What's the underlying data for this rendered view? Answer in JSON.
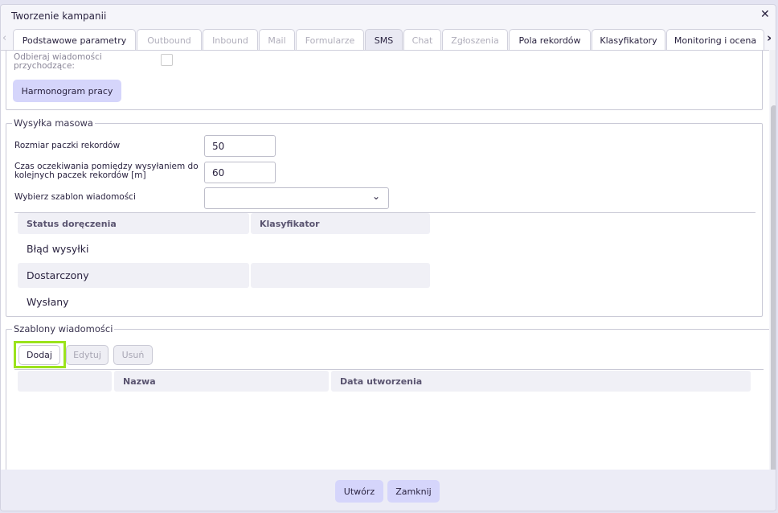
{
  "window": {
    "title": "Tworzenie kampanii",
    "close_icon": "close-icon"
  },
  "tabs": [
    {
      "label": "Podstawowe parametry",
      "state": "enabled"
    },
    {
      "label": "Outbound",
      "state": "disabled"
    },
    {
      "label": "Inbound",
      "state": "disabled"
    },
    {
      "label": "Mail",
      "state": "disabled"
    },
    {
      "label": "Formularze",
      "state": "disabled"
    },
    {
      "label": "SMS",
      "state": "active"
    },
    {
      "label": "Chat",
      "state": "disabled"
    },
    {
      "label": "Zgłoszenia",
      "state": "disabled"
    },
    {
      "label": "Pola rekordów",
      "state": "enabled"
    },
    {
      "label": "Klasyfikatory",
      "state": "enabled"
    },
    {
      "label": "Monitoring i ocena",
      "state": "enabled"
    }
  ],
  "top": {
    "incoming_label": "Odbieraj wiadomości przychodzące:",
    "incoming_checked": false,
    "schedule_button": "Harmonogram pracy"
  },
  "mass": {
    "legend": "Wysyłka masowa",
    "batch_label": "Rozmiar paczki rekordów",
    "batch_value": "50",
    "wait_label": "Czas oczekiwania pomiędzy wysyłaniem do kolejnych paczek rekordów [m]",
    "wait_value": "60",
    "template_label": "Wybierz szablon wiadomości",
    "template_value": "",
    "columns": [
      "Status doręczenia",
      "Klasyfikator"
    ],
    "rows": [
      [
        "Błąd wysyłki",
        ""
      ],
      [
        "Dostarczony",
        ""
      ],
      [
        "Wysłany",
        ""
      ]
    ]
  },
  "templates": {
    "legend": "Szablony wiadomości",
    "add": "Dodaj",
    "edit": "Edytuj",
    "delete": "Usuń",
    "columns": [
      "",
      "Nazwa",
      "Data utworzenia"
    ]
  },
  "footer": {
    "create": "Utwórz",
    "close": "Zamknij"
  },
  "colors": {
    "accent_button": "#d5d5fb",
    "focus_highlight": "#9be31c"
  }
}
